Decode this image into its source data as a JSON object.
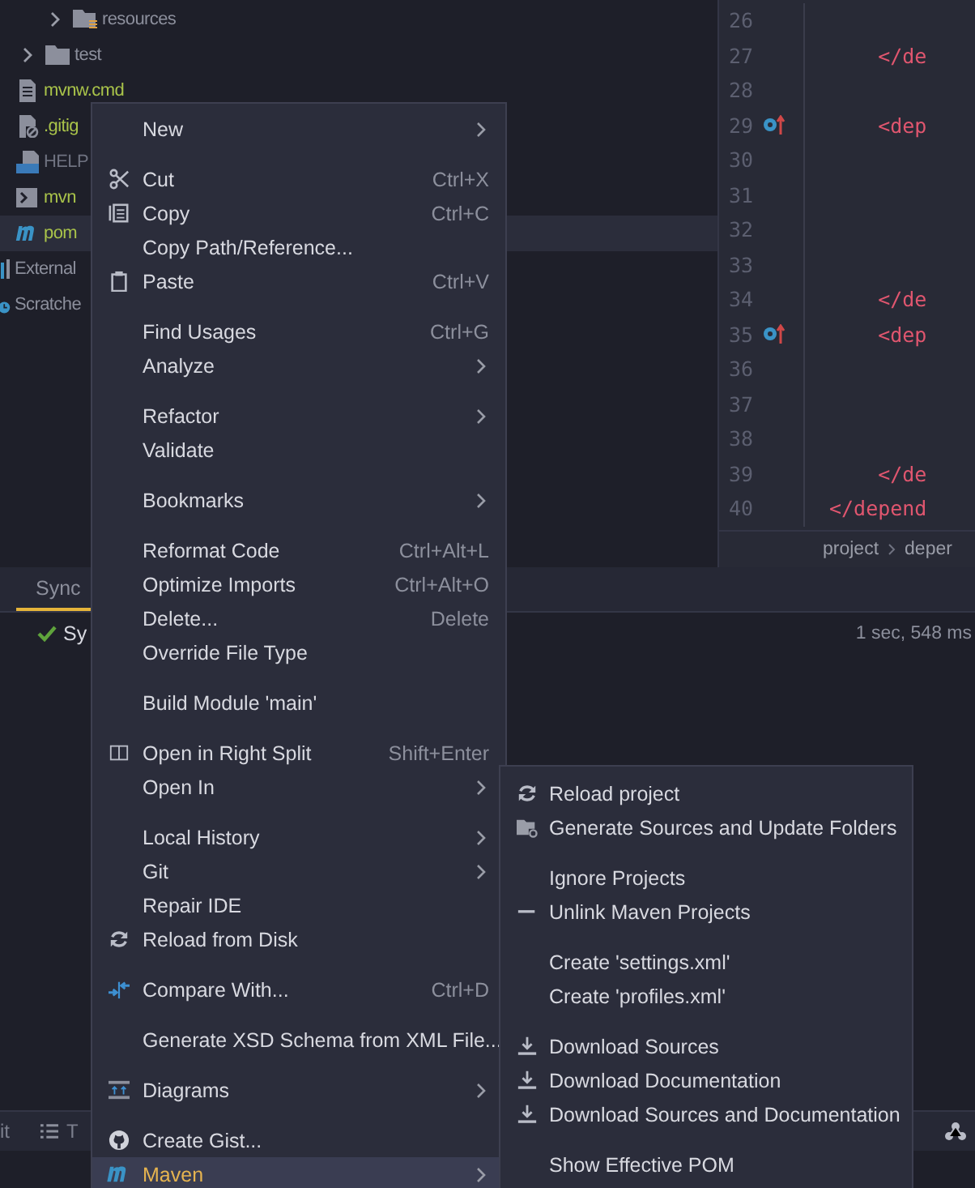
{
  "project_tree": [
    {
      "children": [
        {
          "children": [
            {
              "label": "resources",
              "color": "#8c8f9c",
              "expanded": false,
              "selected": false
            }
          ]
        },
        {
          "label": "test",
          "color": "#8c8f9c",
          "expanded": false,
          "selected": false
        },
        {
          "label": "mvnw.cmd",
          "color": "#a9c34a",
          "selected": false
        },
        {
          "label": ".gitig",
          "color": "#a9c34a",
          "selected": false
        },
        {
          "label": "HELP",
          "color": "#6f7280",
          "selected": false
        },
        {
          "label": "mvn",
          "color": "#a9c34a",
          "selected": false
        },
        {
          "label": "pom",
          "color": "#a9c34a",
          "selected": true
        }
      ]
    },
    {
      "label": "External",
      "color": "#8c8f9c",
      "selected": false
    },
    {
      "label": "Scratche",
      "color": "#8c8f9c",
      "selected": false
    }
  ],
  "editor": {
    "lines": [
      {
        "number": "26"
      },
      {
        "number": "27",
        "code": "    </de"
      },
      {
        "number": "28"
      },
      {
        "number": "29",
        "code": "    <dep",
        "marker": true
      },
      {
        "number": "30"
      },
      {
        "number": "31"
      },
      {
        "number": "32"
      },
      {
        "number": "33"
      },
      {
        "number": "34",
        "code": "    </de"
      },
      {
        "number": "35",
        "code": "    <dep",
        "marker": true
      },
      {
        "number": "36"
      },
      {
        "number": "37"
      },
      {
        "number": "38"
      },
      {
        "number": "39",
        "code": "    </de"
      },
      {
        "number": "40",
        "code": "</depend"
      }
    ],
    "breadcrumbs": [
      "project",
      "deper"
    ]
  },
  "bottom_panel": {
    "tabs": [
      {
        "label": "Sync",
        "selected": true
      }
    ],
    "sync_row": {
      "label": "Sy",
      "time": "1 sec, 548 ms"
    }
  },
  "tool_strip": [
    "it",
    "T"
  ],
  "context_menu": {
    "items": [
      {
        "kind": "item",
        "label": "New",
        "submenu": true,
        "selected": false
      },
      {
        "kind": "separator"
      },
      {
        "kind": "item",
        "label": "Cut",
        "shortcut": "Ctrl+X",
        "selected": false
      },
      {
        "kind": "item",
        "label": "Copy",
        "shortcut": "Ctrl+C",
        "selected": false
      },
      {
        "kind": "item",
        "label": "Copy Path/Reference...",
        "selected": false
      },
      {
        "kind": "item",
        "label": "Paste",
        "shortcut": "Ctrl+V",
        "selected": false
      },
      {
        "kind": "separator"
      },
      {
        "kind": "item",
        "label": "Find Usages",
        "shortcut": "Ctrl+G",
        "selected": false
      },
      {
        "kind": "item",
        "label": "Analyze",
        "submenu": true,
        "selected": false
      },
      {
        "kind": "separator"
      },
      {
        "kind": "item",
        "label": "Refactor",
        "submenu": true,
        "selected": false
      },
      {
        "kind": "item",
        "label": "Validate",
        "selected": false
      },
      {
        "kind": "separator"
      },
      {
        "kind": "item",
        "label": "Bookmarks",
        "submenu": true,
        "selected": false
      },
      {
        "kind": "separator"
      },
      {
        "kind": "item",
        "label": "Reformat Code",
        "shortcut": "Ctrl+Alt+L",
        "selected": false
      },
      {
        "kind": "item",
        "label": "Optimize Imports",
        "shortcut": "Ctrl+Alt+O",
        "selected": false
      },
      {
        "kind": "item",
        "label": "Delete...",
        "shortcut": "Delete",
        "selected": false
      },
      {
        "kind": "item",
        "label": "Override File Type",
        "selected": false
      },
      {
        "kind": "separator"
      },
      {
        "kind": "item",
        "label": "Build Module 'main'",
        "selected": false
      },
      {
        "kind": "separator"
      },
      {
        "kind": "item",
        "label": "Open in Right Split",
        "shortcut": "Shift+Enter",
        "selected": false
      },
      {
        "kind": "item",
        "label": "Open In",
        "submenu": true,
        "selected": false
      },
      {
        "kind": "separator"
      },
      {
        "kind": "item",
        "label": "Local History",
        "submenu": true,
        "selected": false
      },
      {
        "kind": "item",
        "label": "Git",
        "submenu": true,
        "selected": false
      },
      {
        "kind": "item",
        "label": "Repair IDE",
        "selected": false
      },
      {
        "kind": "item",
        "label": "Reload from Disk",
        "selected": false
      },
      {
        "kind": "separator"
      },
      {
        "kind": "item",
        "label": "Compare With...",
        "shortcut": "Ctrl+D",
        "selected": false
      },
      {
        "kind": "separator"
      },
      {
        "kind": "item",
        "label": "Generate XSD Schema from XML File...",
        "selected": false
      },
      {
        "kind": "separator"
      },
      {
        "kind": "item",
        "label": "Diagrams",
        "submenu": true,
        "selected": false
      },
      {
        "kind": "separator"
      },
      {
        "kind": "item",
        "label": "Create Gist...",
        "selected": false
      },
      {
        "kind": "item",
        "label": "Maven",
        "submenu": true,
        "selected": true
      }
    ]
  },
  "maven_submenu": {
    "items": [
      {
        "kind": "item",
        "label": "Reload project",
        "selected": false
      },
      {
        "kind": "item",
        "label": "Generate Sources and Update Folders",
        "selected": false
      },
      {
        "kind": "separator"
      },
      {
        "kind": "item",
        "label": "Ignore Projects",
        "selected": false
      },
      {
        "kind": "item",
        "label": "Unlink Maven Projects",
        "selected": false
      },
      {
        "kind": "separator"
      },
      {
        "kind": "item",
        "label": "Create 'settings.xml'",
        "selected": false
      },
      {
        "kind": "item",
        "label": "Create 'profiles.xml'",
        "selected": false
      },
      {
        "kind": "separator"
      },
      {
        "kind": "item",
        "label": "Download Sources",
        "selected": false
      },
      {
        "kind": "item",
        "label": "Download Documentation",
        "selected": false
      },
      {
        "kind": "item",
        "label": "Download Sources and Documentation",
        "selected": false
      },
      {
        "kind": "separator"
      },
      {
        "kind": "item",
        "label": "Show Effective POM",
        "selected": false
      }
    ]
  }
}
